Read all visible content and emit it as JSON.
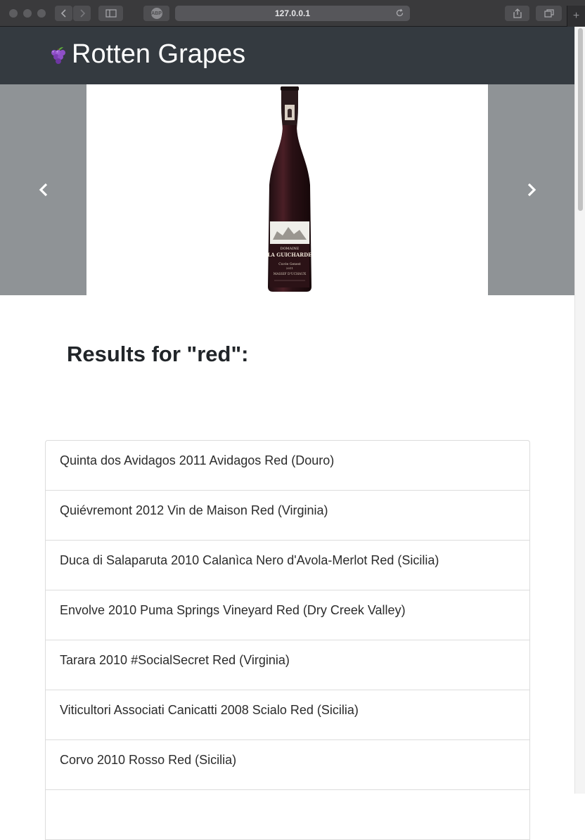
{
  "browser": {
    "url": "127.0.0.1",
    "adblock_label": "ABP",
    "new_tab_label": "+"
  },
  "navbar": {
    "brand_title": "Rotten Grapes",
    "brand_icon": "grape-icon",
    "background_color": "#343a40"
  },
  "carousel": {
    "prev_icon": "chevron-left-icon",
    "next_icon": "chevron-right-icon",
    "slide_image": "wine-bottle",
    "bottle_label": {
      "line1": "DOMAINE",
      "line2": "LA GUICHARDE",
      "line3": "Cuvée Genest",
      "line4": "2011",
      "line5": "MASSIF D'UCHAUX"
    }
  },
  "results": {
    "heading": "Results for \"red\":",
    "items": [
      "Quinta dos Avidagos 2011 Avidagos Red (Douro)",
      "Quiévremont 2012 Vin de Maison Red (Virginia)",
      "Duca di Salaparuta 2010 Calanìca Nero d'Avola-Merlot Red (Sicilia)",
      "Envolve 2010 Puma Springs Vineyard Red (Dry Creek Valley)",
      "Tarara 2010 #SocialSecret Red (Virginia)",
      "Viticultori Associati Canicatti 2008 Scialo Red (Sicilia)",
      "Corvo 2010 Rosso Red (Sicilia)",
      ""
    ]
  }
}
